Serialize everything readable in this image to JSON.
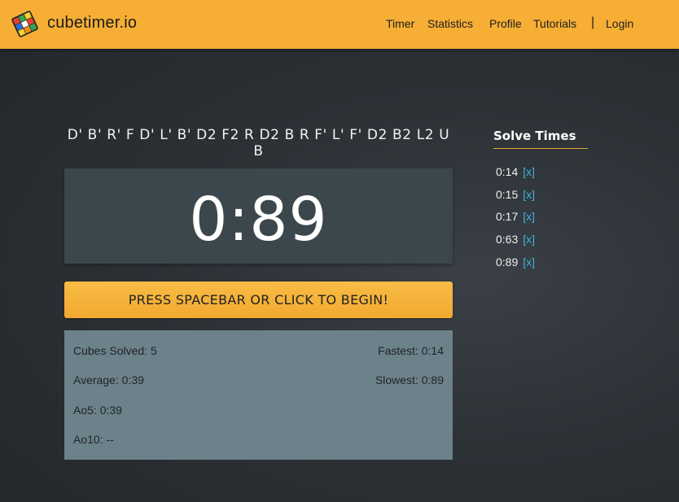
{
  "brand": {
    "name": "cubetimer.io"
  },
  "nav": {
    "items": [
      {
        "label": "Timer"
      },
      {
        "label": "Statistics"
      },
      {
        "label": "Profile"
      },
      {
        "label": "Tutorials"
      }
    ],
    "separator": "|",
    "login": "Login"
  },
  "scramble": "D' B' R' F D' L' B' D2 F2 R D2 B R F' L' F' D2 B2 L2 U B",
  "timer": {
    "display": "0:89"
  },
  "start_button": {
    "label": "PRESS SPACEBAR OR CLICK TO BEGIN!"
  },
  "stats": {
    "cubes_solved": "Cubes Solved: 5",
    "fastest": "Fastest: 0:14",
    "average": "Average: 0:39",
    "slowest": "Slowest: 0:89",
    "ao5": "Ao5: 0:39",
    "ao10": "Ao10: --"
  },
  "solve_times": {
    "title": "Solve Times",
    "delete_label": "[x]",
    "items": [
      {
        "time": "0:14"
      },
      {
        "time": "0:15"
      },
      {
        "time": "0:17"
      },
      {
        "time": "0:63"
      },
      {
        "time": "0:89"
      }
    ]
  },
  "colors": {
    "navbar": "#f6ae35",
    "accent_link": "#3fb4d7",
    "timer_bg": "#3c474d",
    "stats_bg": "#6d818a"
  }
}
